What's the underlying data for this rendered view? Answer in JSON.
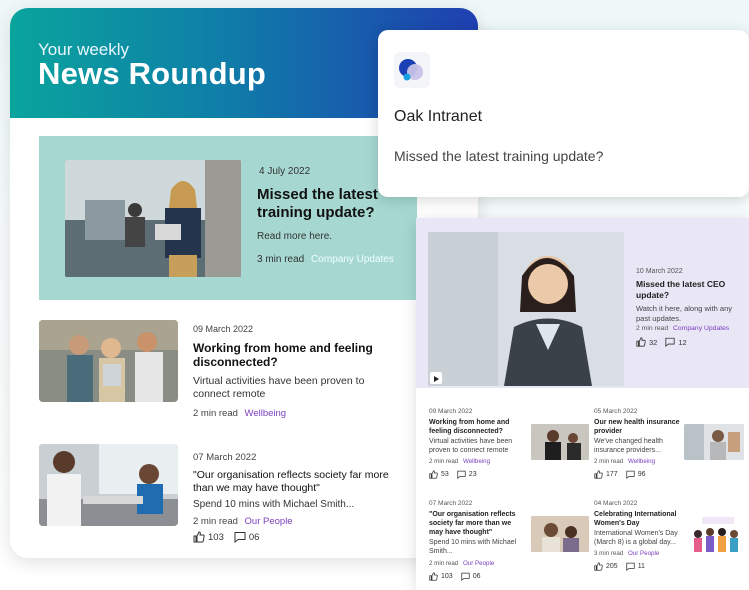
{
  "newsletter": {
    "subtitle": "Your weekly",
    "title": "News Roundup",
    "feature": {
      "date": "4 July 2022",
      "title": "Missed the latest training update?",
      "description": "Read more here.",
      "read_time": "3 min read",
      "category": "Company Updates"
    },
    "articles": [
      {
        "date": "09 March 2022",
        "title": "Working from home and feeling disconnected?",
        "description": "Virtual activities have been proven to connect remote",
        "read_time": "2 min read",
        "category": "Wellbeing"
      },
      {
        "date": "07 March 2022",
        "title": "\"Our organisation reflects society far more than we may have thought\"",
        "description": "Spend 10 mins with Michael Smith...",
        "read_time": "2 min read",
        "category": "Our People",
        "likes": "103",
        "comments": "06"
      }
    ]
  },
  "notification": {
    "app_name": "Oak Intranet",
    "message": "Missed the latest training update?"
  },
  "intranet": {
    "featured": {
      "date": "10 March 2022",
      "title": "Missed the latest CEO update?",
      "description": "Watch it here, along with any past updates.",
      "read_time": "2 min read",
      "category": "Company Updates",
      "likes": "32",
      "comments": "12"
    },
    "articles": [
      {
        "date": "09 March 2022",
        "title": "Working from home and feeling disconnected?",
        "description": "Virtual activities have been proven to connect remote",
        "read_time": "2 min read",
        "category": "Wellbeing",
        "likes": "53",
        "comments": "23"
      },
      {
        "date": "05 March 2022",
        "title": "Our new health insurance provider",
        "description": "We've changed health insurance providers...",
        "read_time": "2 min read",
        "category": "Wellbeing",
        "likes": "177",
        "comments": "96"
      },
      {
        "date": "07 March 2022",
        "title": "\"Our organisation reflects society far more than we may have thought\"",
        "description": "Spend 10 mins with Michael Smith...",
        "read_time": "2 min read",
        "category": "Our People",
        "likes": "103",
        "comments": "06"
      },
      {
        "date": "04 March 2022",
        "title": "Celebrating International Women's Day",
        "description": "International Women's Day (March 8) is a global day...",
        "read_time": "3 min read",
        "category": "Our People",
        "likes": "205",
        "comments": "11"
      }
    ]
  },
  "colors": {
    "teal": "#0aa49d",
    "blue": "#1f3fb0",
    "feature_bg": "#a6d8d1",
    "accent_purple": "#7a3fbf",
    "ceo_bg": "#e9e6f5"
  }
}
